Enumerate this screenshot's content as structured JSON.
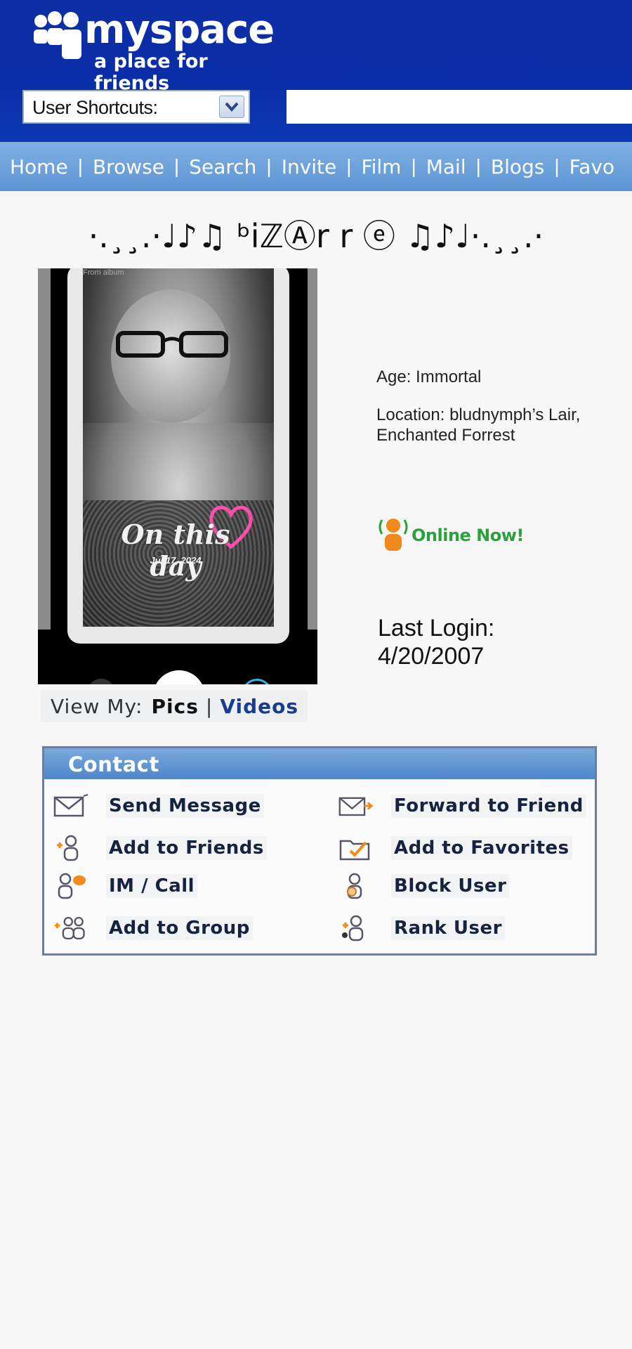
{
  "header": {
    "logo_text": "myspace",
    "tagline": "a place for friends",
    "shortcuts_label": "User Shortcuts:"
  },
  "nav": {
    "items": [
      "Home",
      "Browse",
      "Search",
      "Invite",
      "Film",
      "Mail",
      "Blogs",
      "Favo"
    ]
  },
  "profile": {
    "name": "·.¸¸.·♩♪♫ ᵇiℤⒶr r ⓔ ♫♪♩·.¸¸.·",
    "age": "Age: Immortal",
    "location": "Location: bludnymph’s Lair, Enchanted Forrest",
    "online_text": "Online Now!",
    "last_login_label": "Last Login:",
    "last_login_date": "4/20/2007"
  },
  "photo": {
    "album_label": "From album",
    "overlay_title": "On this day",
    "overlay_date": "Jul 17, 2024"
  },
  "view_my": {
    "label": "View My:",
    "pics": "Pics",
    "separator": "|",
    "videos": "Videos"
  },
  "contact": {
    "title": "Contact",
    "items": [
      {
        "label": "Send Message",
        "icon": "envelope-icon"
      },
      {
        "label": "Forward to Friend",
        "icon": "forward-envelope-icon"
      },
      {
        "label": "Add to Friends",
        "icon": "add-friend-icon"
      },
      {
        "label": "Add to Favorites",
        "icon": "favorites-icon"
      },
      {
        "label": "IM / Call",
        "icon": "im-call-icon"
      },
      {
        "label": "Block User",
        "icon": "block-user-icon"
      },
      {
        "label": "Add to Group",
        "icon": "add-group-icon"
      },
      {
        "label": "Rank User",
        "icon": "rank-user-icon"
      }
    ]
  },
  "colors": {
    "header_blue": "#0a2ea8",
    "nav_blue": "#6fa3dc",
    "online_green": "#2aa13b",
    "contact_header": "#5b8fcf"
  }
}
